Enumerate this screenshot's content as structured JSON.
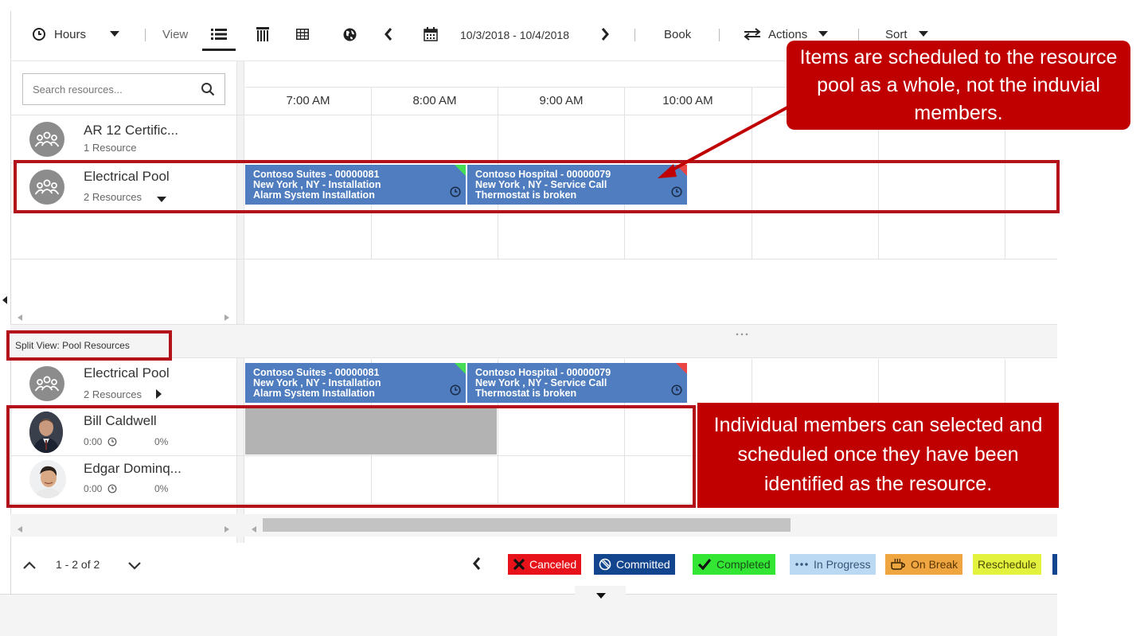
{
  "toolbar": {
    "hours_label": "Hours",
    "view_label": "View",
    "date_range": "10/3/2018 - 10/4/2018",
    "book_label": "Book",
    "actions_label": "Actions",
    "sort_label": "Sort"
  },
  "search": {
    "placeholder": "Search resources..."
  },
  "time_headers": [
    "7:00 AM",
    "8:00 AM",
    "9:00 AM",
    "10:00 AM"
  ],
  "top_resources": [
    {
      "name": "AR 12 Certific...",
      "sub": "1 Resource"
    },
    {
      "name": "Electrical Pool",
      "sub": "2 Resources"
    }
  ],
  "bookings": [
    {
      "title": "Contoso Suites - 00000081",
      "line2": "New York , NY - Installation",
      "line3": "Alarm System Installation",
      "corner": "#44dd55"
    },
    {
      "title": "Contoso Hospital - 00000079",
      "line2": "New York , NY - Service Call",
      "line3": "Thermostat is broken",
      "corner": "#e94545"
    }
  ],
  "split_view_label": "Split View: Pool Resources",
  "bottom_resources": [
    {
      "name": "Electrical Pool",
      "sub": "2 Resources"
    },
    {
      "name": "Bill Caldwell",
      "hours": "0:00",
      "pct": "0%"
    },
    {
      "name": "Edgar Dominq...",
      "hours": "0:00",
      "pct": "0%"
    }
  ],
  "pagination": "1 - 2 of 2",
  "legend": [
    {
      "label": "Canceled",
      "bg": "#e8121b",
      "fg": "#ffffff"
    },
    {
      "label": "Committed",
      "bg": "#13458f",
      "fg": "#ffffff"
    },
    {
      "label": "Completed",
      "bg": "#33e633",
      "fg": "#1a4d1a"
    },
    {
      "label": "In Progress",
      "bg": "#bcd9f4",
      "fg": "#335577"
    },
    {
      "label": "On Break",
      "bg": "#f0a640",
      "fg": "#5a3600"
    },
    {
      "label": "Reschedule",
      "bg": "#e3f23c",
      "fg": "#4a4a00"
    }
  ],
  "callouts": {
    "top": "Items are scheduled to the resource pool as a whole, not the induvial members.",
    "bottom": "Individual members can selected and scheduled once they have been identified as the resource."
  },
  "colors": {
    "booking": "#4f7dbf",
    "annotation_red": "#c00000",
    "unavailable_block": "#b3b3b3"
  }
}
